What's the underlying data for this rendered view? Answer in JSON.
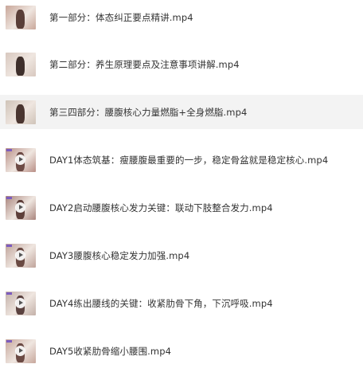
{
  "files": [
    {
      "name": "第一部分：体态纠正要点精讲.mp4",
      "thumb": {
        "bg": "#c9a79a",
        "figure": "#5a3e38",
        "play": false
      }
    },
    {
      "name": "第二部分：养生原理要点及注意事项讲解.mp4",
      "thumb": {
        "bg": "#d8c8bf",
        "figure": "#3e2f2b",
        "play": false
      }
    },
    {
      "name": "第三四部分：腰腹核心力量燃脂+全身燃脂.mp4",
      "thumb": {
        "bg": "#cfc3b8",
        "figure": "#4a3530",
        "play": false
      },
      "selected": true
    },
    {
      "name": "DAY1体态筑基：瘦腰腹最重要的一步，稳定骨盆就是稳定核心.mp4",
      "thumb": {
        "bg": "#b98f86",
        "figure": "#6d4b45",
        "play": true
      }
    },
    {
      "name": "DAY2启动腰腹核心发力关键：联动下肢整合发力.mp4",
      "thumb": {
        "bg": "#a9847c",
        "figure": "#5e3f3a",
        "play": true
      }
    },
    {
      "name": "DAY3腰腹核心稳定发力加强.mp4",
      "thumb": {
        "bg": "#bfa39a",
        "figure": "#6a4a43",
        "play": true
      }
    },
    {
      "name": "DAY4练出腰线的关键：收紧肋骨下角，下沉呼吸.mp4",
      "thumb": {
        "bg": "#c3b0a8",
        "figure": "#5b4240",
        "play": true
      }
    },
    {
      "name": "DAY5收紧肋骨缩小腰围.mp4",
      "thumb": {
        "bg": "#c7a79c",
        "figure": "#6b4a44",
        "play": true
      }
    }
  ]
}
